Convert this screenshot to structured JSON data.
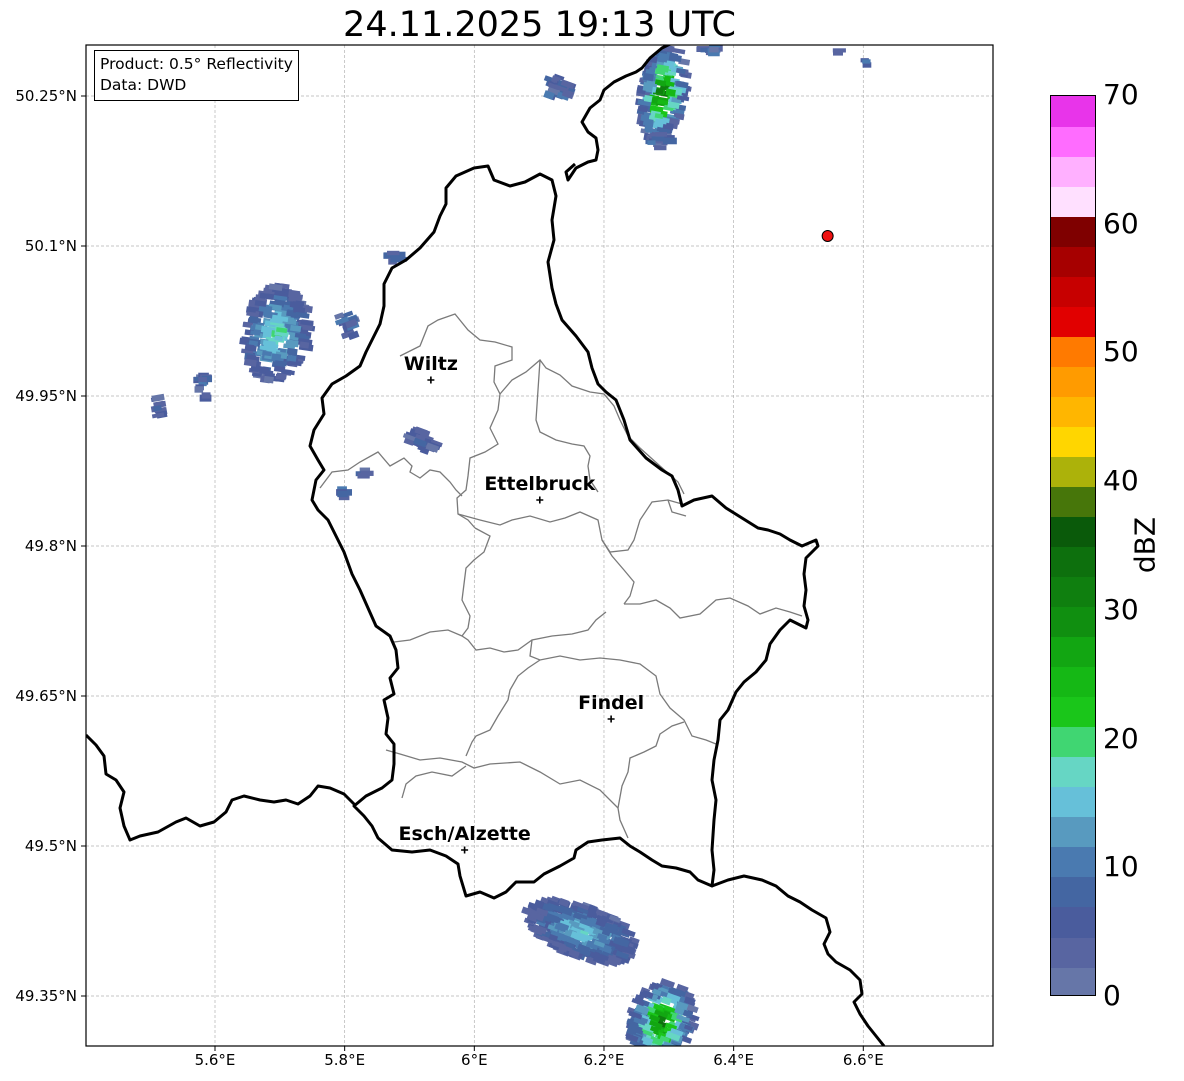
{
  "title": "24.11.2025 19:13 UTC",
  "info": {
    "product": "Product: 0.5° Reflectivity",
    "data": "Data: DWD"
  },
  "lat_ticks": [
    "50.25°N",
    "50.1°N",
    "49.95°N",
    "49.8°N",
    "49.65°N",
    "49.5°N",
    "49.35°N"
  ],
  "lon_ticks": [
    "5.6°E",
    "5.8°E",
    "6°E",
    "6.2°E",
    "6.4°E",
    "6.6°E"
  ],
  "cities": [
    {
      "name": "Wiltz",
      "lat": 49.966,
      "lon": 5.933
    },
    {
      "name": "Ettelbruck",
      "lat": 49.846,
      "lon": 6.101
    },
    {
      "name": "Findel",
      "lat": 49.627,
      "lon": 6.211
    },
    {
      "name": "Esch/Alzette",
      "lat": 49.496,
      "lon": 5.985
    }
  ],
  "marker": {
    "lat": 50.11,
    "lon": 6.545,
    "color": "#ee1111"
  },
  "colorbar": {
    "label": "dBZ",
    "ticks": [
      "0",
      "10",
      "20",
      "30",
      "40",
      "50",
      "60",
      "70"
    ],
    "min": 0,
    "max": 70,
    "step": 2.5,
    "colors": [
      "#6676a8",
      "#5865a1",
      "#4a5c9d",
      "#4466a2",
      "#4a7ab0",
      "#589abf",
      "#66c0d9",
      "#66d6c4",
      "#40d672",
      "#1ac61a",
      "#15b815",
      "#12a612",
      "#108f10",
      "#0f7f0f",
      "#0d700d",
      "#0a5a0a",
      "#47760a",
      "#acb20a",
      "#ffd600",
      "#ffb600",
      "#ff9b00",
      "#ff7a00",
      "#e10000",
      "#c70000",
      "#a60000",
      "#7f0000",
      "#ffe0ff",
      "#ffb0ff",
      "#ff6cff",
      "#e834ea"
    ]
  },
  "colors": {
    "border": "#000000",
    "district": "#7a7a7a",
    "grid": "#b3b3b3"
  }
}
